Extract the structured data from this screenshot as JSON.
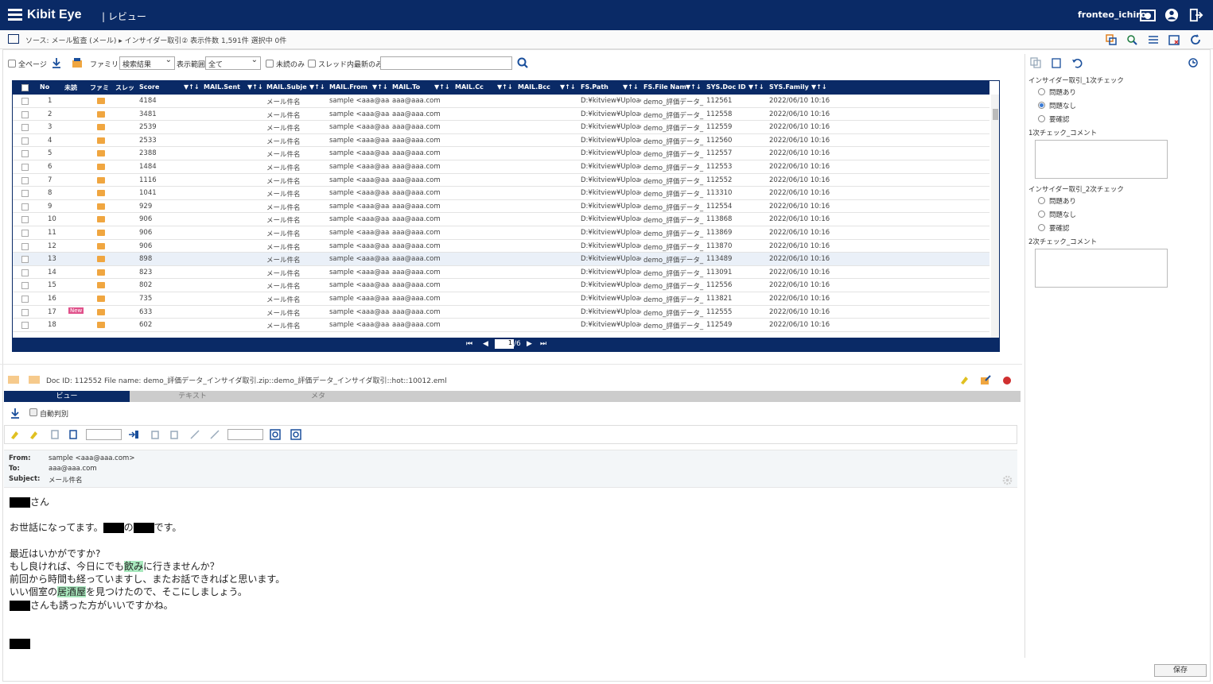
{
  "header": {
    "logo": "Kibit Eye",
    "subtitle": "| レビュー",
    "user": "fronteo_ichiro"
  },
  "breadcrumb": {
    "text": "ソース: メール監査 (メール) ▸ インサイダー取引② 表示件数 1,591件 選択中 0件"
  },
  "toolbar": {
    "all_pages": "全ページ",
    "family_label": "ファミリ",
    "family_value": "検索結果",
    "display_label": "表示範囲",
    "display_value": "全て",
    "unread_only": "未読のみ",
    "thread_latest": "スレッド内最新のみ"
  },
  "grid": {
    "columns": [
      "No",
      "未読",
      "ファミ",
      "スレッ",
      "Score",
      "MAIL.Sent",
      "MAIL.Subje",
      "MAIL.From",
      "MAIL.To",
      "MAIL.Cc",
      "MAIL.Bcc",
      "FS.Path",
      "FS.File Nam",
      "SYS.Doc ID",
      "SYS.Family"
    ],
    "rows": [
      {
        "no": "1",
        "score": "4184",
        "subject": "メール件名",
        "from": "sample <aaa@aaa.com>",
        "to": "aaa@aaa.com",
        "path": "D:¥kitview¥Upload",
        "file": "demo_評価データ_",
        "docid": "112561",
        "family": "2022/06/10 10:16",
        "new": ""
      },
      {
        "no": "2",
        "score": "3481",
        "subject": "メール件名",
        "from": "sample <aaa@aaa.com>",
        "to": "aaa@aaa.com",
        "path": "D:¥kitview¥Upload",
        "file": "demo_評価データ_",
        "docid": "112558",
        "family": "2022/06/10 10:16",
        "new": ""
      },
      {
        "no": "3",
        "score": "2539",
        "subject": "メール件名",
        "from": "sample <aaa@aaa.com>",
        "to": "aaa@aaa.com",
        "path": "D:¥kitview¥Upload",
        "file": "demo_評価データ_",
        "docid": "112559",
        "family": "2022/06/10 10:16",
        "new": ""
      },
      {
        "no": "4",
        "score": "2533",
        "subject": "メール件名",
        "from": "sample <aaa@aaa.com>",
        "to": "aaa@aaa.com",
        "path": "D:¥kitview¥Upload",
        "file": "demo_評価データ_",
        "docid": "112560",
        "family": "2022/06/10 10:16",
        "new": ""
      },
      {
        "no": "5",
        "score": "2388",
        "subject": "メール件名",
        "from": "sample <aaa@aaa.com>",
        "to": "aaa@aaa.com",
        "path": "D:¥kitview¥Upload",
        "file": "demo_評価データ_",
        "docid": "112557",
        "family": "2022/06/10 10:16",
        "new": ""
      },
      {
        "no": "6",
        "score": "1484",
        "subject": "メール件名",
        "from": "sample <aaa@aaa.com>",
        "to": "aaa@aaa.com",
        "path": "D:¥kitview¥Upload",
        "file": "demo_評価データ_",
        "docid": "112553",
        "family": "2022/06/10 10:16",
        "new": ""
      },
      {
        "no": "7",
        "score": "1116",
        "subject": "メール件名",
        "from": "sample <aaa@aaa.com>",
        "to": "aaa@aaa.com",
        "path": "D:¥kitview¥Upload",
        "file": "demo_評価データ_",
        "docid": "112552",
        "family": "2022/06/10 10:16",
        "new": ""
      },
      {
        "no": "8",
        "score": "1041",
        "subject": "メール件名",
        "from": "sample <aaa@aaa.com>",
        "to": "aaa@aaa.com",
        "path": "D:¥kitview¥Upload",
        "file": "demo_評価データ_",
        "docid": "113310",
        "family": "2022/06/10 10:16",
        "new": ""
      },
      {
        "no": "9",
        "score": "929",
        "subject": "メール件名",
        "from": "sample <aaa@aaa.com>",
        "to": "aaa@aaa.com",
        "path": "D:¥kitview¥Upload",
        "file": "demo_評価データ_",
        "docid": "112554",
        "family": "2022/06/10 10:16",
        "new": ""
      },
      {
        "no": "10",
        "score": "906",
        "subject": "メール件名",
        "from": "sample <aaa@aaa.com>",
        "to": "aaa@aaa.com",
        "path": "D:¥kitview¥Upload",
        "file": "demo_評価データ_",
        "docid": "113868",
        "family": "2022/06/10 10:16",
        "new": ""
      },
      {
        "no": "11",
        "score": "906",
        "subject": "メール件名",
        "from": "sample <aaa@aaa.com>",
        "to": "aaa@aaa.com",
        "path": "D:¥kitview¥Upload",
        "file": "demo_評価データ_",
        "docid": "113869",
        "family": "2022/06/10 10:16",
        "new": ""
      },
      {
        "no": "12",
        "score": "906",
        "subject": "メール件名",
        "from": "sample <aaa@aaa.com>",
        "to": "aaa@aaa.com",
        "path": "D:¥kitview¥Upload",
        "file": "demo_評価データ_",
        "docid": "113870",
        "family": "2022/06/10 10:16",
        "new": ""
      },
      {
        "no": "13",
        "score": "898",
        "subject": "メール件名",
        "from": "sample <aaa@aaa.com>",
        "to": "aaa@aaa.com",
        "path": "D:¥kitview¥Upload",
        "file": "demo_評価データ_",
        "docid": "113489",
        "family": "2022/06/10 10:16",
        "new": ""
      },
      {
        "no": "14",
        "score": "823",
        "subject": "メール件名",
        "from": "sample <aaa@aaa.com>",
        "to": "aaa@aaa.com",
        "path": "D:¥kitview¥Upload",
        "file": "demo_評価データ_",
        "docid": "113091",
        "family": "2022/06/10 10:16",
        "new": ""
      },
      {
        "no": "15",
        "score": "802",
        "subject": "メール件名",
        "from": "sample <aaa@aaa.com>",
        "to": "aaa@aaa.com",
        "path": "D:¥kitview¥Upload",
        "file": "demo_評価データ_",
        "docid": "112556",
        "family": "2022/06/10 10:16",
        "new": ""
      },
      {
        "no": "16",
        "score": "735",
        "subject": "メール件名",
        "from": "sample <aaa@aaa.com>",
        "to": "aaa@aaa.com",
        "path": "D:¥kitview¥Upload",
        "file": "demo_評価データ_",
        "docid": "113821",
        "family": "2022/06/10 10:16",
        "new": ""
      },
      {
        "no": "17",
        "score": "633",
        "subject": "メール件名",
        "from": "sample <aaa@aaa.com>",
        "to": "aaa@aaa.com",
        "path": "D:¥kitview¥Upload",
        "file": "demo_評価データ_",
        "docid": "112555",
        "family": "2022/06/10 10:16",
        "new": "New"
      },
      {
        "no": "18",
        "score": "602",
        "subject": "メール件名",
        "from": "sample <aaa@aaa.com>",
        "to": "aaa@aaa.com",
        "path": "D:¥kitview¥Upload",
        "file": "demo_評価データ_",
        "docid": "112549",
        "family": "2022/06/10 10:16",
        "new": ""
      }
    ],
    "selected_row": "13",
    "page_current": "1",
    "page_total": "/6"
  },
  "doc": {
    "label": "Doc ID: 112552   File name: demo_評価データ_インサイダ取引.zip::demo_評価データ_インサイダ取引::hot::10012.eml",
    "tabs": [
      "ビュー",
      "テキスト",
      "メタ"
    ],
    "auto_detect": "自動判別"
  },
  "mail": {
    "from_key": "From:",
    "from_val": "sample <aaa@aaa.com>",
    "to_key": "To:",
    "to_val": "aaa@aaa.com",
    "subject_key": "Subject:",
    "subject_val": "メール件名",
    "l1": "さん",
    "l2a": "お世話になってます。",
    "l2b": "の",
    "l2c": "です。",
    "l3": "最近はいかがですか?",
    "l4a": "もし良ければ、今日にでも",
    "l4b": "飲み",
    "l4c": "に行きませんか？",
    "l5": "前回から時間も経っていますし、またお話できればと思います。",
    "l6a": "いい個室の",
    "l6b": "居酒屋",
    "l6c": "を見つけたので、そこにしましょう。",
    "l7": "さんも誘った方がいいですかね。"
  },
  "sidebar": {
    "check1_title": "インサイダー取引_1次チェック",
    "check1_opts": [
      "問題あり",
      "問題なし",
      "要確認"
    ],
    "check1_selected": "問題なし",
    "comment1": "1次チェック_コメント",
    "check2_title": "インサイダー取引_2次チェック",
    "check2_opts": [
      "問題あり",
      "問題なし",
      "要確認"
    ],
    "comment2": "2次チェック_コメント",
    "save": "保存"
  }
}
